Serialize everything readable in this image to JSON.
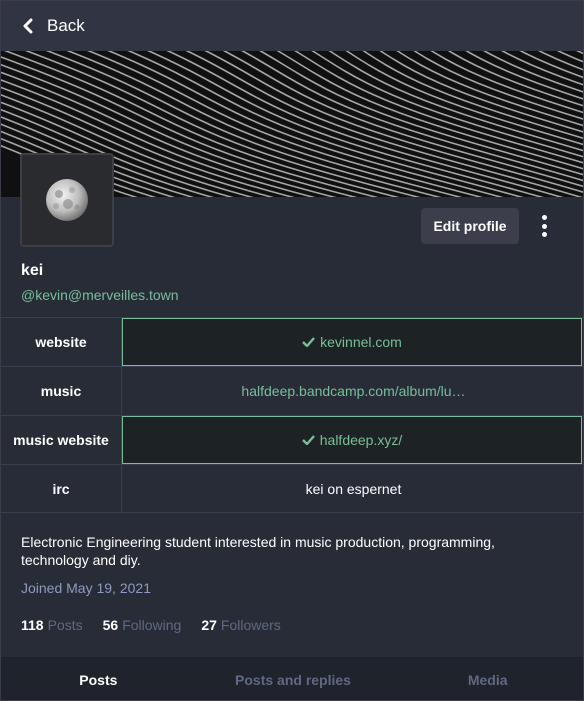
{
  "nav": {
    "back_label": "Back"
  },
  "profile": {
    "display_name": "kei",
    "handle": "@kevin@merveilles.town",
    "edit_label": "Edit profile",
    "bio": "Electronic Engineering student interested in music production, programming, technology and diy.",
    "joined": "Joined May 19, 2021"
  },
  "fields": [
    {
      "name": "website",
      "value": "kevinnel.com",
      "verified": true
    },
    {
      "name": "music",
      "value": "halfdeep.bandcamp.com/album/lu…",
      "verified": false
    },
    {
      "name": "music website",
      "value": "halfdeep.xyz/",
      "verified": true
    },
    {
      "name": "irc",
      "value": "kei on espernet",
      "verified": false
    }
  ],
  "counts": {
    "posts": {
      "num": "118",
      "label": "Posts"
    },
    "following": {
      "num": "56",
      "label": "Following"
    },
    "followers": {
      "num": "27",
      "label": "Followers"
    }
  },
  "tabs": [
    {
      "label": "Posts",
      "active": true
    },
    {
      "label": "Posts and replies",
      "active": false
    },
    {
      "label": "Media",
      "active": false
    }
  ],
  "icons": {
    "back": "chevron-left-icon",
    "verified": "check-icon",
    "menu": "kebab-menu-icon"
  },
  "colors": {
    "background": "#282c37",
    "accent": "#79bd9a",
    "muted": "#606984",
    "joined": "#8d9ac2"
  }
}
